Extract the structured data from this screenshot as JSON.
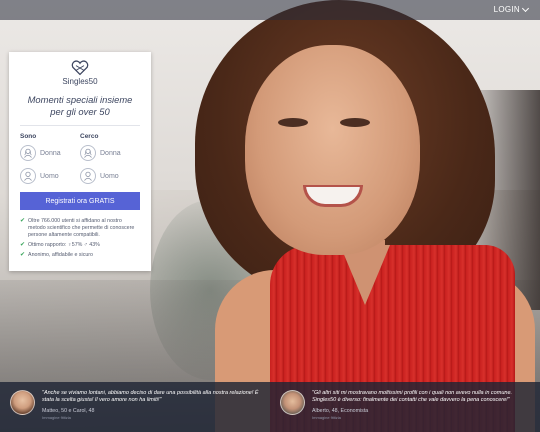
{
  "header": {
    "login_label": "LOGIN"
  },
  "brand": {
    "logo_text": "Singles50"
  },
  "card": {
    "headline": "Momenti speciali insieme per gli over 50",
    "sono": {
      "title": "Sono",
      "options": [
        "Donna",
        "Uomo"
      ]
    },
    "cerco": {
      "title": "Cerco",
      "options": [
        "Donna",
        "Uomo"
      ]
    },
    "cta_label": "Registrati ora GRATIS",
    "bullets": [
      "Oltre 766.000 utenti si affidano al nostro metodo scientifico che permette di conoscere persone altamente compatibili.",
      "Ottimo rapporto: ♀57% ♂ 43%",
      "Anonimo, affidabile e sicuro"
    ]
  },
  "testimonials": [
    {
      "quote": "\"Anche se viviamo lontani, abbiamo deciso di dare una possibilità alla nostra relazione! È stata la scelta giusta! Il vero amore non ha limiti!\"",
      "author": "Matteo, 50 e Carol, 48",
      "image_label": "Immagine fittizia"
    },
    {
      "quote": "\"Gli altri siti mi mostravano moltissimi profili con i quali non avevo nulla in comune. Singles50 è diverso: finalmente dei contatti che vale davvero la pena conoscere!\"",
      "author": "Alberto, 48, Economista",
      "image_label": "Immagine fittizia"
    }
  ],
  "colors": {
    "accent": "#5663d6",
    "brand_text": "#3d4660",
    "check": "#3aa55c",
    "dress": "#c8201f"
  },
  "icons": [
    "heart-logo-icon",
    "female-icon",
    "male-icon",
    "check-icon",
    "chevron-down-icon"
  ]
}
